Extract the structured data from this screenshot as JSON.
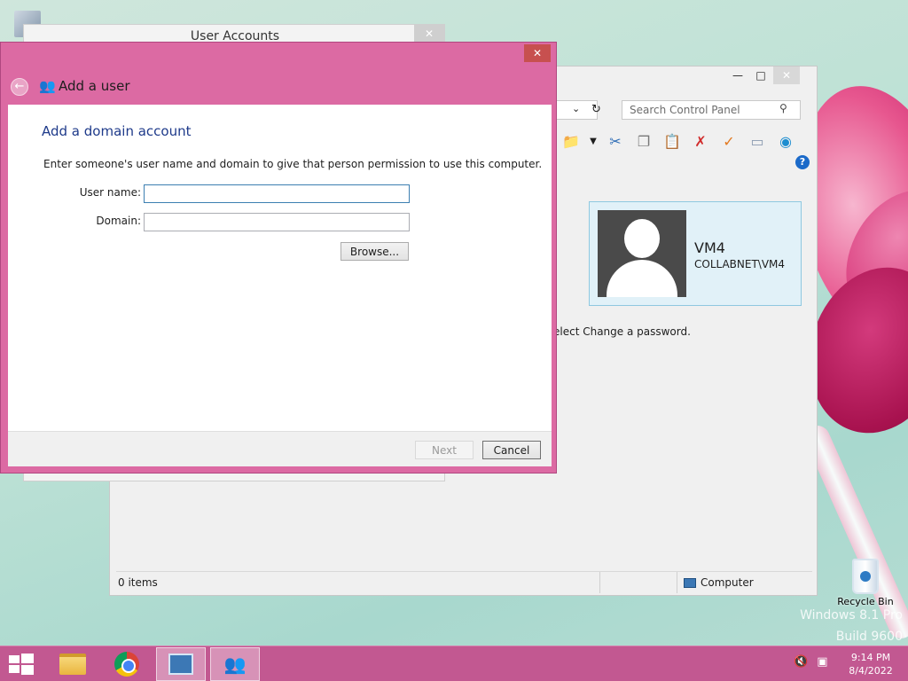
{
  "desktop": {
    "recycle_bin_label": "Recycle Bin",
    "watermark_line1": "Windows 8.1 Pro",
    "watermark_line2": "Build 9600"
  },
  "control_panel": {
    "search_placeholder": "Search Control Panel",
    "user_card": {
      "name": "VM4",
      "domain_account": "COLLABNET\\VM4"
    },
    "hint_text": "elect Change a password.",
    "status_items": "0 items",
    "status_location": "Computer"
  },
  "user_accounts": {
    "title": "User Accounts"
  },
  "add_user_dialog": {
    "header_title": "Add a user",
    "heading": "Add a domain account",
    "description": "Enter someone's user name and domain to give that person permission to use this computer.",
    "username_label": "User name:",
    "username_value": "",
    "domain_label": "Domain:",
    "domain_value": "",
    "browse_label": "Browse...",
    "next_label": "Next",
    "cancel_label": "Cancel"
  },
  "taskbar": {
    "time": "9:14 PM",
    "date": "8/4/2022"
  }
}
